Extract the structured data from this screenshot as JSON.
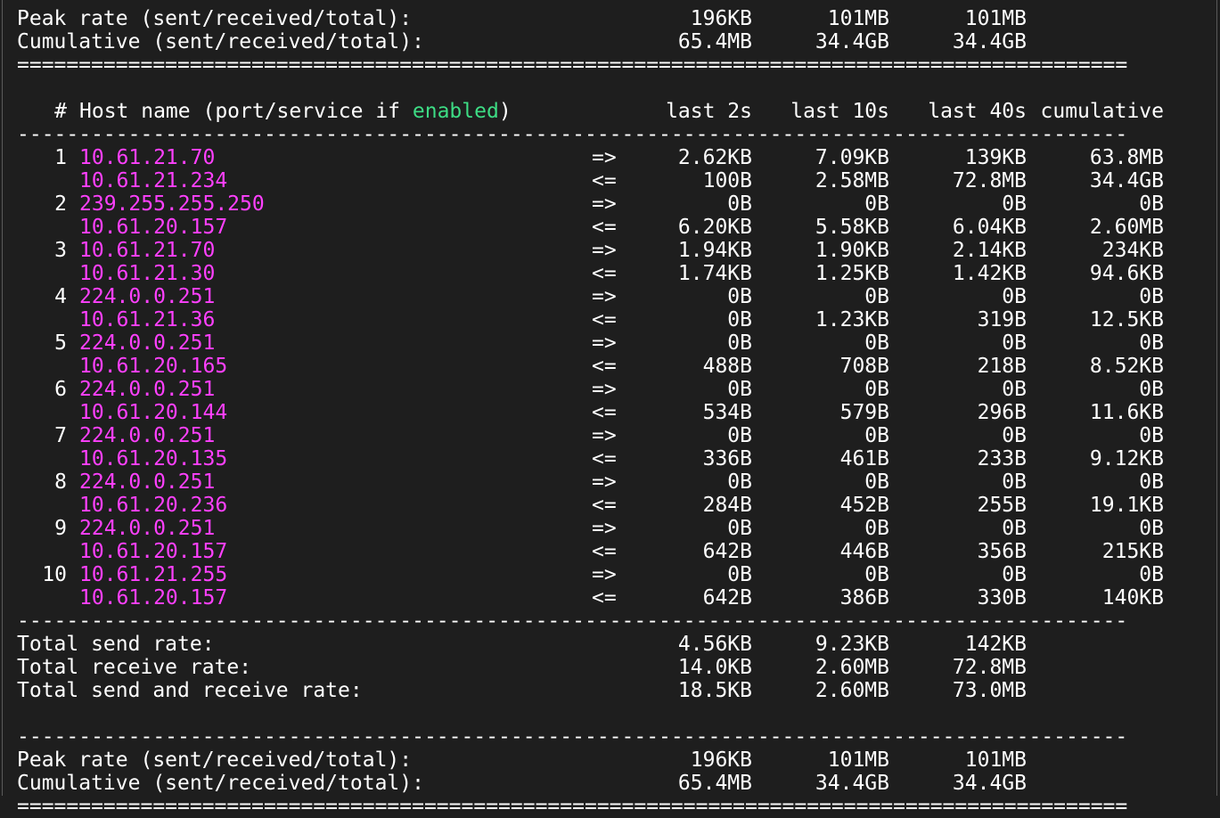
{
  "colors": {
    "background": "#1e1e1e",
    "text": "#ffffff",
    "host": "#ff40ff",
    "highlight": "#3ddc84"
  },
  "top_summary": {
    "peak": {
      "label": "Peak rate (sent/received/total):",
      "values": [
        "196KB",
        "101MB",
        "101MB"
      ]
    },
    "cumulative": {
      "label": "Cumulative (sent/received/total):",
      "values": [
        "65.4MB",
        "34.4GB",
        "34.4GB"
      ]
    }
  },
  "header": {
    "num": "#",
    "host_pre": "Host name (port/service if ",
    "host_enabled": "enabled",
    "host_post": ")",
    "cols": [
      "last 2s",
      "last 10s",
      "last 40s",
      "cumulative"
    ]
  },
  "rows": [
    {
      "num": "1",
      "host": "10.61.21.70",
      "dir": "=>",
      "v": [
        "2.62KB",
        "7.09KB",
        "139KB",
        "63.8MB"
      ]
    },
    {
      "num": "",
      "host": "10.61.21.234",
      "dir": "<=",
      "v": [
        "100B",
        "2.58MB",
        "72.8MB",
        "34.4GB"
      ]
    },
    {
      "num": "2",
      "host": "239.255.255.250",
      "dir": "=>",
      "v": [
        "0B",
        "0B",
        "0B",
        "0B"
      ]
    },
    {
      "num": "",
      "host": "10.61.20.157",
      "dir": "<=",
      "v": [
        "6.20KB",
        "5.58KB",
        "6.04KB",
        "2.60MB"
      ]
    },
    {
      "num": "3",
      "host": "10.61.21.70",
      "dir": "=>",
      "v": [
        "1.94KB",
        "1.90KB",
        "2.14KB",
        "234KB"
      ]
    },
    {
      "num": "",
      "host": "10.61.21.30",
      "dir": "<=",
      "v": [
        "1.74KB",
        "1.25KB",
        "1.42KB",
        "94.6KB"
      ]
    },
    {
      "num": "4",
      "host": "224.0.0.251",
      "dir": "=>",
      "v": [
        "0B",
        "0B",
        "0B",
        "0B"
      ]
    },
    {
      "num": "",
      "host": "10.61.21.36",
      "dir": "<=",
      "v": [
        "0B",
        "1.23KB",
        "319B",
        "12.5KB"
      ]
    },
    {
      "num": "5",
      "host": "224.0.0.251",
      "dir": "=>",
      "v": [
        "0B",
        "0B",
        "0B",
        "0B"
      ]
    },
    {
      "num": "",
      "host": "10.61.20.165",
      "dir": "<=",
      "v": [
        "488B",
        "708B",
        "218B",
        "8.52KB"
      ]
    },
    {
      "num": "6",
      "host": "224.0.0.251",
      "dir": "=>",
      "v": [
        "0B",
        "0B",
        "0B",
        "0B"
      ]
    },
    {
      "num": "",
      "host": "10.61.20.144",
      "dir": "<=",
      "v": [
        "534B",
        "579B",
        "296B",
        "11.6KB"
      ]
    },
    {
      "num": "7",
      "host": "224.0.0.251",
      "dir": "=>",
      "v": [
        "0B",
        "0B",
        "0B",
        "0B"
      ]
    },
    {
      "num": "",
      "host": "10.61.20.135",
      "dir": "<=",
      "v": [
        "336B",
        "461B",
        "233B",
        "9.12KB"
      ]
    },
    {
      "num": "8",
      "host": "224.0.0.251",
      "dir": "=>",
      "v": [
        "0B",
        "0B",
        "0B",
        "0B"
      ]
    },
    {
      "num": "",
      "host": "10.61.20.236",
      "dir": "<=",
      "v": [
        "284B",
        "452B",
        "255B",
        "19.1KB"
      ]
    },
    {
      "num": "9",
      "host": "224.0.0.251",
      "dir": "=>",
      "v": [
        "0B",
        "0B",
        "0B",
        "0B"
      ]
    },
    {
      "num": "",
      "host": "10.61.20.157",
      "dir": "<=",
      "v": [
        "642B",
        "446B",
        "356B",
        "215KB"
      ]
    },
    {
      "num": "10",
      "host": "10.61.21.255",
      "dir": "=>",
      "v": [
        "0B",
        "0B",
        "0B",
        "0B"
      ]
    },
    {
      "num": "",
      "host": "10.61.20.157",
      "dir": "<=",
      "v": [
        "642B",
        "386B",
        "330B",
        "140KB"
      ]
    }
  ],
  "totals": [
    {
      "label": "Total send rate:",
      "values": [
        "4.56KB",
        "9.23KB",
        "142KB"
      ]
    },
    {
      "label": "Total receive rate:",
      "values": [
        "14.0KB",
        "2.60MB",
        "72.8MB"
      ]
    },
    {
      "label": "Total send and receive rate:",
      "values": [
        "18.5KB",
        "2.60MB",
        "73.0MB"
      ]
    }
  ],
  "bottom_summary": {
    "peak": {
      "label": "Peak rate (sent/received/total):",
      "values": [
        "196KB",
        "101MB",
        "101MB"
      ]
    },
    "cumulative": {
      "label": "Cumulative (sent/received/total):",
      "values": [
        "65.4MB",
        "34.4GB",
        "34.4GB"
      ]
    }
  },
  "rules": {
    "double": "==========================================================================================",
    "single": "------------------------------------------------------------------------------------------"
  }
}
